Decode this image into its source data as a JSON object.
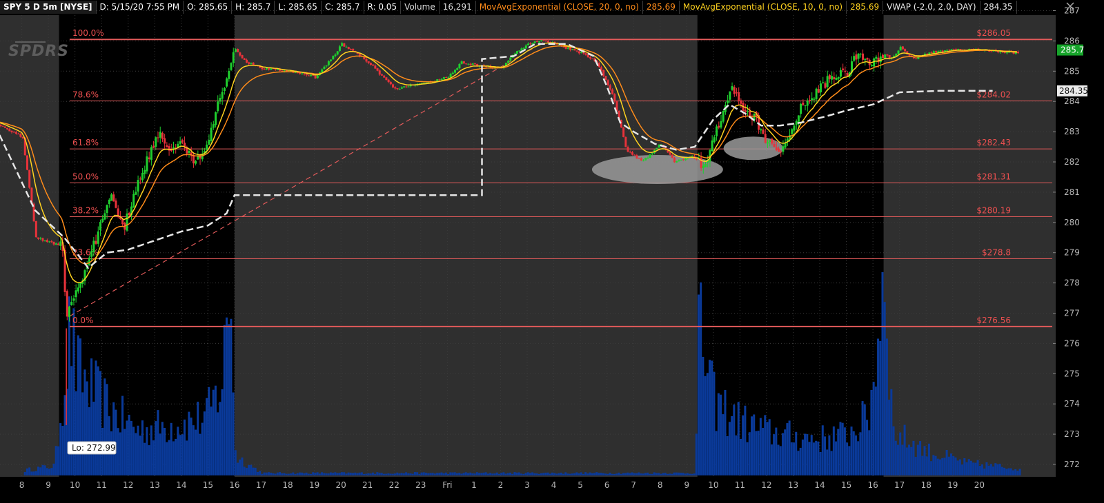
{
  "header": {
    "symbol": "SPY 5 D 5m [NYSE]",
    "date": "D: 5/15/20 7:55 PM",
    "open": "O: 285.65",
    "high": "H: 285.7",
    "low": "L: 285.65",
    "close": "C: 285.7",
    "range": "R: 0.05",
    "volume_label": "Volume",
    "volume_value": "16,291",
    "ema20_label": "MovAvgExponential (CLOSE, 20, 0, no)",
    "ema20_value": "285.69",
    "ema10_label": "MovAvgExponential (CLOSE, 10, 0, no)",
    "ema10_value": "285.69",
    "vwap_label": "VWAP (-2.0, 2.0, DAY)",
    "vwap_value": "284.35"
  },
  "logo_text": "SPDRS",
  "colors": {
    "background": "#000000",
    "extended_hours": "#2f2f2f",
    "grid": "#3c3c3c",
    "up_candle": "#1fcf2e",
    "down_candle": "#e8323a",
    "ema20": "#ff8c1a",
    "ema10": "#ffd21f",
    "vwap": "#e6e6e6",
    "fib_line": "#e25a5a",
    "fib_text": "#ee5050",
    "volume": "#0a3a9a",
    "price_axis_text": "#b8b8b8",
    "ellipse": "#9a9a9a",
    "last_price_box": "#16a32a"
  },
  "chart_data": {
    "type": "candlestick",
    "timeframe": "5m",
    "price_axis": {
      "min": 271.7,
      "max": 287,
      "ticks": [
        272,
        273,
        274,
        275,
        276,
        277,
        278,
        279,
        280,
        281,
        282,
        283,
        284,
        285,
        286,
        287
      ]
    },
    "time_labels": [
      "8",
      "9",
      "10",
      "11",
      "12",
      "13",
      "14",
      "15",
      "16",
      "17",
      "18",
      "19",
      "20",
      "21",
      "22",
      "23",
      "Fri",
      "1",
      "2",
      "3",
      "4",
      "5",
      "6",
      "7",
      "8",
      "9",
      "10",
      "11",
      "12",
      "13",
      "14",
      "15",
      "16",
      "17",
      "18",
      "19",
      "20"
    ],
    "price_path": [
      [
        7,
        283.3
      ],
      [
        8,
        282.8
      ],
      [
        8.5,
        279.5
      ],
      [
        9.5,
        279.2
      ],
      [
        9.65,
        276.8
      ],
      [
        9.85,
        277.3
      ],
      [
        10.2,
        278.0
      ],
      [
        10.8,
        279.6
      ],
      [
        11.3,
        281.0
      ],
      [
        11.8,
        279.8
      ],
      [
        12.4,
        281.5
      ],
      [
        13.1,
        283.0
      ],
      [
        13.5,
        282.4
      ],
      [
        14.0,
        282.7
      ],
      [
        14.4,
        282.0
      ],
      [
        14.8,
        282.3
      ],
      [
        15.3,
        283.8
      ],
      [
        15.75,
        285.1
      ],
      [
        16.0,
        285.7
      ],
      [
        16.4,
        285.3
      ],
      [
        17,
        285.1
      ],
      [
        18,
        285.0
      ],
      [
        19,
        284.8
      ],
      [
        19.6,
        285.4
      ],
      [
        20,
        285.9
      ],
      [
        21,
        285.3
      ],
      [
        22,
        284.4
      ],
      [
        23,
        284.6
      ],
      [
        24,
        284.8
      ],
      [
        24.5,
        285.3
      ],
      [
        25,
        285.2
      ],
      [
        26,
        285.1
      ],
      [
        26.5,
        285.6
      ],
      [
        27,
        285.9
      ],
      [
        27.5,
        286.0
      ],
      [
        28,
        285.9
      ],
      [
        29,
        285.6
      ],
      [
        29.6,
        285.3
      ],
      [
        30.2,
        284.2
      ],
      [
        30.7,
        282.4
      ],
      [
        31.3,
        282.0
      ],
      [
        32.0,
        282.6
      ],
      [
        32.5,
        282.0
      ],
      [
        33.2,
        282.2
      ],
      [
        33.6,
        281.8
      ],
      [
        34.2,
        283.3
      ],
      [
        34.7,
        284.5
      ],
      [
        35.1,
        283.6
      ],
      [
        35.5,
        283.5
      ],
      [
        35.9,
        282.8
      ],
      [
        36.3,
        282.4
      ],
      [
        36.7,
        282.6
      ],
      [
        37.2,
        283.7
      ],
      [
        37.8,
        284.3
      ],
      [
        38.4,
        284.8
      ],
      [
        39.0,
        285.0
      ],
      [
        39.4,
        285.6
      ],
      [
        39.9,
        285.2
      ],
      [
        40.3,
        285.6
      ],
      [
        40.7,
        285.4
      ],
      [
        41.0,
        285.8
      ],
      [
        41.5,
        285.4
      ],
      [
        42,
        285.6
      ],
      [
        43,
        285.7
      ],
      [
        44,
        285.7
      ],
      [
        45.5,
        285.6
      ]
    ],
    "fibonacci": [
      {
        "level": "100.0%",
        "price": 286.05,
        "label": "$286.05"
      },
      {
        "level": "78.6%",
        "price": 284.02,
        "label": "$284.02"
      },
      {
        "level": "61.8%",
        "price": 282.43,
        "label": "$282.43"
      },
      {
        "level": "50.0%",
        "price": 281.31,
        "label": "$281.31"
      },
      {
        "level": "38.2%",
        "price": 280.19,
        "label": "$280.19"
      },
      {
        "level": "23.6%",
        "price": 278.8,
        "label": "$278.8"
      },
      {
        "level": "0.0%",
        "price": 276.56,
        "label": "$276.56"
      }
    ],
    "vwap_path": [
      [
        7,
        283.2
      ],
      [
        8.5,
        280.4
      ],
      [
        9.6,
        279.5
      ],
      [
        10.5,
        278.5
      ],
      [
        11.2,
        279.0
      ],
      [
        12,
        279.1
      ],
      [
        13,
        279.4
      ],
      [
        14,
        279.7
      ],
      [
        15,
        279.9
      ],
      [
        15.7,
        280.3
      ],
      [
        16,
        280.9
      ],
      [
        25.3,
        280.9
      ],
      [
        25.3,
        285.4
      ],
      [
        26.5,
        285.5
      ],
      [
        27.3,
        285.9
      ],
      [
        28.5,
        285.9
      ],
      [
        29.5,
        285.5
      ],
      [
        30.0,
        284.5
      ],
      [
        30.5,
        283.3
      ],
      [
        31.0,
        283.0
      ],
      [
        31.8,
        282.6
      ],
      [
        32.6,
        282.4
      ],
      [
        33.3,
        282.5
      ],
      [
        34.0,
        283.4
      ],
      [
        34.6,
        283.9
      ],
      [
        35.2,
        283.6
      ],
      [
        35.8,
        283.2
      ],
      [
        36.5,
        283.2
      ],
      [
        37.3,
        283.3
      ],
      [
        38.2,
        283.5
      ],
      [
        39.0,
        283.7
      ],
      [
        40.0,
        283.9
      ],
      [
        41.0,
        284.3
      ],
      [
        42.5,
        284.35
      ],
      [
        44.5,
        284.35
      ]
    ],
    "trendline": {
      "from": [
        9.8,
        276.9
      ],
      "to": [
        27.6,
        285.95
      ]
    },
    "volume_profile": [
      [
        8.0,
        0.02
      ],
      [
        9.2,
        0.04
      ],
      [
        9.8,
        0.62
      ],
      [
        10.0,
        0.44
      ],
      [
        10.6,
        0.36
      ],
      [
        11.3,
        0.27
      ],
      [
        12.3,
        0.19
      ],
      [
        13.2,
        0.2
      ],
      [
        14.2,
        0.22
      ],
      [
        14.9,
        0.24
      ],
      [
        15.5,
        0.38
      ],
      [
        15.8,
        0.84
      ],
      [
        16.0,
        0.08
      ],
      [
        17,
        0.01
      ],
      [
        33.3,
        0.01
      ],
      [
        33.4,
        0.62
      ],
      [
        34.0,
        0.3
      ],
      [
        35.0,
        0.22
      ],
      [
        36.0,
        0.18
      ],
      [
        37.0,
        0.16
      ],
      [
        38.0,
        0.15
      ],
      [
        39.0,
        0.17
      ],
      [
        39.8,
        0.24
      ],
      [
        40.2,
        0.6
      ],
      [
        40.4,
        0.92
      ],
      [
        40.7,
        0.18
      ],
      [
        42.0,
        0.1
      ],
      [
        43.5,
        0.05
      ],
      [
        45.5,
        0.03
      ]
    ],
    "annotations": [
      {
        "type": "low_label",
        "text": "Lo: 272.99"
      },
      {
        "type": "ellipse",
        "area": "281.3-282.2 consolidation"
      },
      {
        "type": "ellipse",
        "area": "282.1-282.8 consolidation"
      }
    ],
    "last_price": {
      "value": 285.7,
      "label": "285.7"
    },
    "vwap_last": {
      "value": 284.35,
      "label": "284.35"
    }
  }
}
